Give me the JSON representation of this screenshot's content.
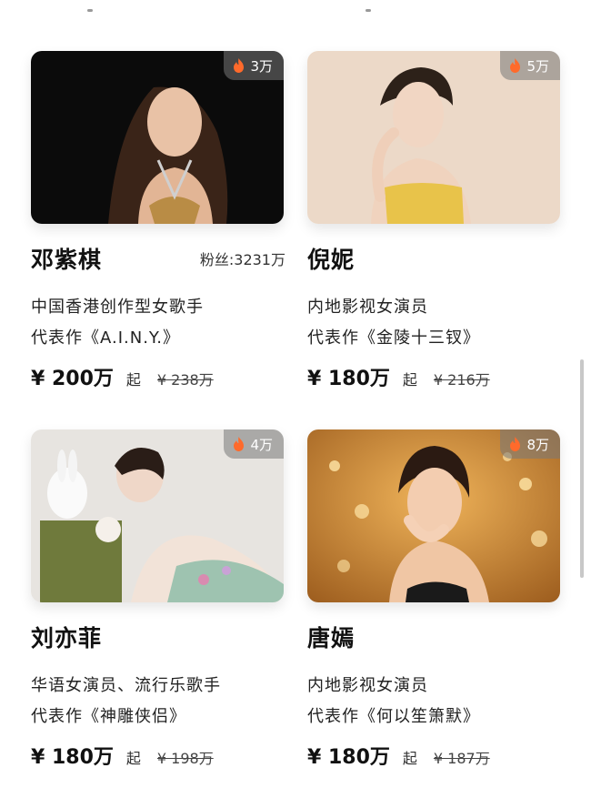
{
  "cards": [
    {
      "heat": "3万",
      "name": "邓紫棋",
      "fans": "粉丝:3231万",
      "desc": "中国香港创作型女歌手",
      "works": "代表作《A.I.N.Y.》",
      "price": "¥ 200万",
      "qi": "起",
      "original": "¥ 238万",
      "photo_bg": "#0a0a0a"
    },
    {
      "heat": "5万",
      "name": "倪妮",
      "fans": "",
      "desc": "内地影视女演员",
      "works": "代表作《金陵十三钗》",
      "price": "¥ 180万",
      "qi": "起",
      "original": "¥ 216万",
      "photo_bg": "#ead7c5"
    },
    {
      "heat": "4万",
      "name": "刘亦菲",
      "fans": "",
      "desc": "华语女演员、流行乐歌手",
      "works": "代表作《神雕侠侣》",
      "price": "¥ 180万",
      "qi": "起",
      "original": "¥ 198万",
      "photo_bg": "#e6e3df"
    },
    {
      "heat": "8万",
      "name": "唐嫣",
      "fans": "",
      "desc": "内地影视女演员",
      "works": "代表作《何以笙箫默》",
      "price": "¥ 180万",
      "qi": "起",
      "original": "¥ 187万",
      "photo_bg": "#c07a2a"
    }
  ],
  "colors": {
    "flame": "#ff6a2b",
    "heat_badge_bg": "rgba(120,120,120,0.55)"
  }
}
